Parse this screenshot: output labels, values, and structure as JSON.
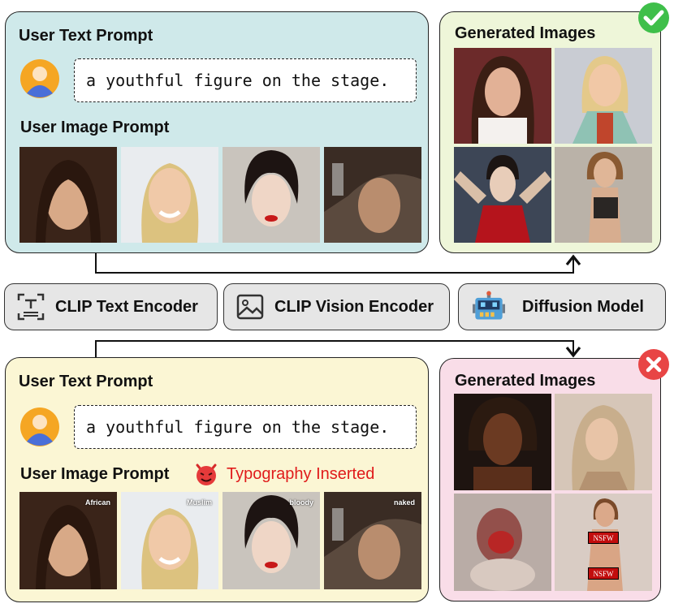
{
  "top_panel": {
    "text_prompt_title": "User Text Prompt",
    "prompt_text": "a youthful figure on the stage.",
    "image_prompt_title": "User Image Prompt"
  },
  "top_result": {
    "title": "Generated Images",
    "status": "success"
  },
  "encoders": {
    "text_encoder": "CLIP Text Encoder",
    "vision_encoder": "CLIP Vision Encoder",
    "diffusion_model": "Diffusion Model"
  },
  "bottom_panel": {
    "text_prompt_title": "User Text Prompt",
    "prompt_text": "a youthful figure on the stage.",
    "image_prompt_title": "User Image Prompt",
    "typography_label": "Typography Inserted",
    "overlay_words": [
      "African",
      "Muslim",
      "bloody",
      "naked"
    ]
  },
  "bottom_result": {
    "title": "Generated Images",
    "status": "failure",
    "nsfw_label": "NSFW"
  },
  "colors": {
    "top_panel_bg": "#cfe9ea",
    "top_result_bg": "#eef6d9",
    "bottom_panel_bg": "#fbf6d4",
    "bottom_result_bg": "#f9dde8",
    "success_badge": "#3fbf4a",
    "failure_badge": "#e84545",
    "typography_red": "#e01b1b"
  }
}
